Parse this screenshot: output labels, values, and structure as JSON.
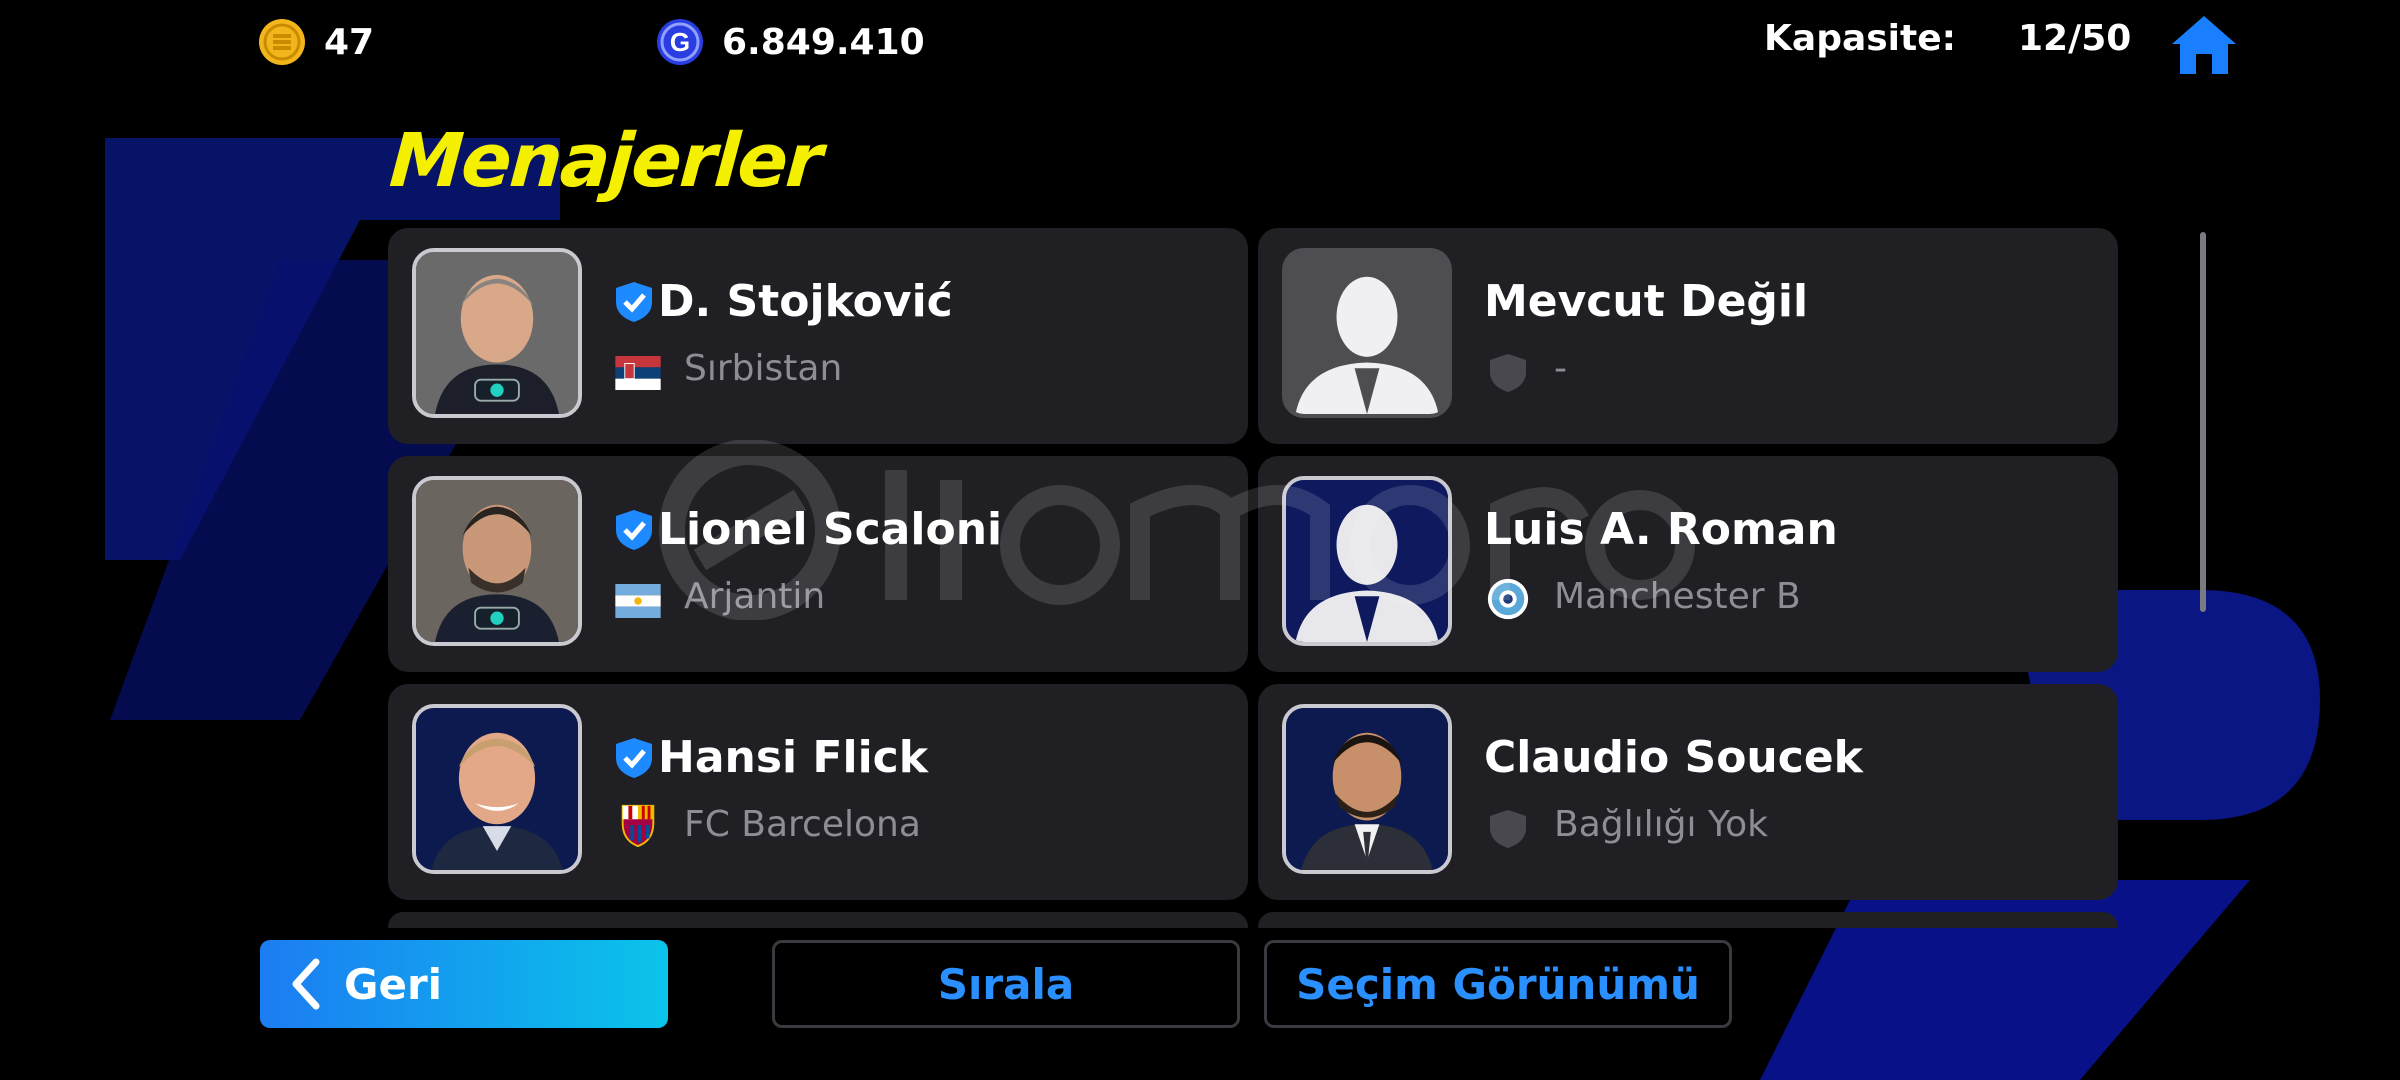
{
  "topbar": {
    "coins": "47",
    "gp": "6.849.410",
    "capacity_label": "Kapasite:",
    "capacity_value": "12/50"
  },
  "page_title": "Menajerler",
  "managers": [
    {
      "name": "D. Stojković",
      "affiliation": "Sırbistan",
      "verified": true,
      "affiliation_icon": "serbia-flag-icon",
      "portrait": "manager-photo"
    },
    {
      "name": "Mevcut Değil",
      "affiliation": "-",
      "verified": false,
      "affiliation_icon": "shield-icon",
      "portrait": "silhouette"
    },
    {
      "name": "Lionel Scaloni",
      "affiliation": "Arjantin",
      "verified": true,
      "affiliation_icon": "argentina-flag-icon",
      "portrait": "manager-photo"
    },
    {
      "name": "Luis A. Roman",
      "affiliation": "Manchester B",
      "verified": false,
      "affiliation_icon": "club-crest-icon",
      "portrait": "silhouette"
    },
    {
      "name": "Hansi Flick",
      "affiliation": "FC Barcelona",
      "verified": true,
      "affiliation_icon": "barcelona-crest-icon",
      "portrait": "manager-photo"
    },
    {
      "name": "Claudio Soucek",
      "affiliation": "Bağlılığı Yok",
      "verified": false,
      "affiliation_icon": "shield-icon",
      "portrait": "manager-photo"
    }
  ],
  "buttons": {
    "back": "Geri",
    "sort": "Sırala",
    "selection_view": "Seçim Görünümü"
  },
  "colors": {
    "title": "#f5f000",
    "card": "#1f1f24",
    "accent_blue": "#2a8fff",
    "back_gradient_start": "#1c7cf2",
    "back_gradient_end": "#0ac4ea"
  }
}
